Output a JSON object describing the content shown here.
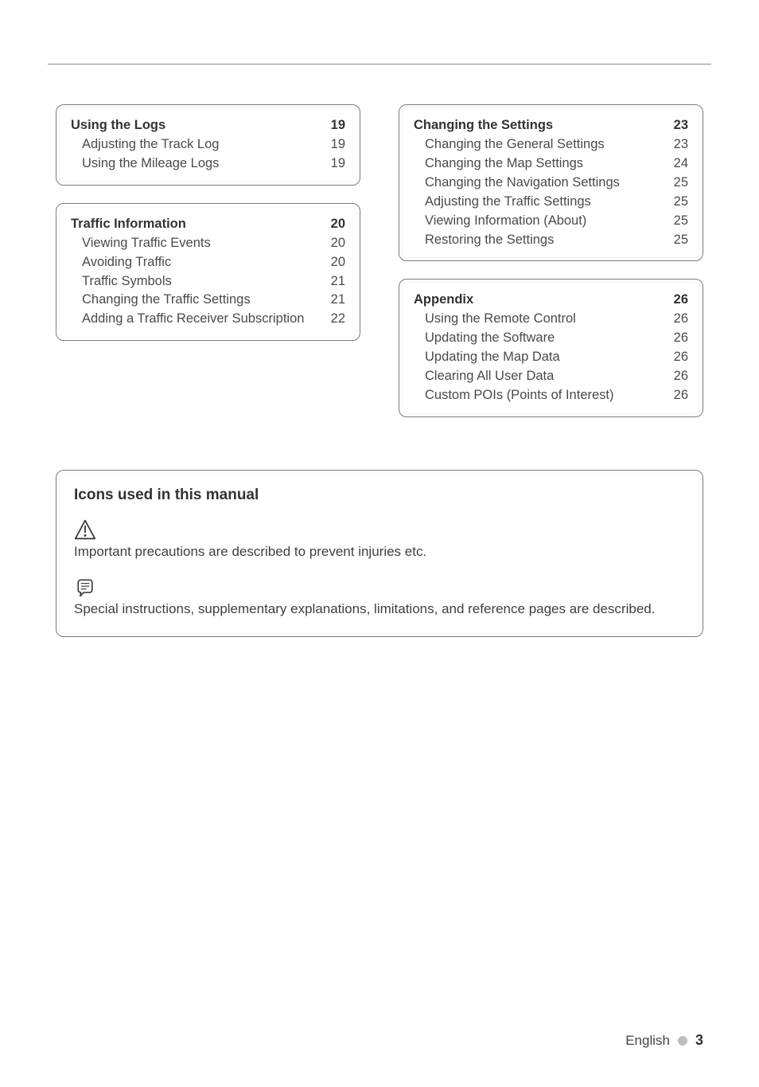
{
  "sections_left": [
    {
      "heading": {
        "label": "Using the Logs",
        "page": "19"
      },
      "items": [
        {
          "label": "Adjusting the Track Log",
          "page": "19"
        },
        {
          "label": "Using the Mileage Logs",
          "page": "19"
        }
      ]
    },
    {
      "heading": {
        "label": "Traffic Information",
        "page": "20"
      },
      "items": [
        {
          "label": "Viewing Traffic Events",
          "page": "20"
        },
        {
          "label": "Avoiding Traffic",
          "page": "20"
        },
        {
          "label": "Traffic Symbols",
          "page": "21"
        },
        {
          "label": "Changing the Traffic Settings",
          "page": "21"
        },
        {
          "label": "Adding a Traffic Receiver Subscription",
          "page": "22"
        }
      ]
    }
  ],
  "sections_right": [
    {
      "heading": {
        "label": "Changing the Settings",
        "page": "23"
      },
      "items": [
        {
          "label": "Changing the General Settings",
          "page": "23"
        },
        {
          "label": "Changing the Map Settings",
          "page": "24"
        },
        {
          "label": "Changing the Navigation Settings",
          "page": "25"
        },
        {
          "label": "Adjusting the Traffic Settings",
          "page": "25"
        },
        {
          "label": "Viewing Information (About)",
          "page": "25"
        },
        {
          "label": "Restoring the Settings",
          "page": "25"
        }
      ]
    },
    {
      "heading": {
        "label": "Appendix",
        "page": "26"
      },
      "items": [
        {
          "label": "Using the Remote Control",
          "page": "26"
        },
        {
          "label": "Updating the Software",
          "page": "26"
        },
        {
          "label": "Updating the Map Data",
          "page": "26"
        },
        {
          "label": "Clearing All User Data",
          "page": "26"
        },
        {
          "label": "Custom POIs (Points of Interest)",
          "page": "26"
        }
      ]
    }
  ],
  "icons_box": {
    "title": "Icons used in this manual",
    "entries": [
      {
        "icon": "warning-icon",
        "text": "Important precautions are described to prevent injuries etc."
      },
      {
        "icon": "note-icon",
        "text": "Special instructions, supplementary explanations, limitations, and reference pages are described."
      }
    ]
  },
  "footer": {
    "language": "English",
    "page_number": "3"
  }
}
